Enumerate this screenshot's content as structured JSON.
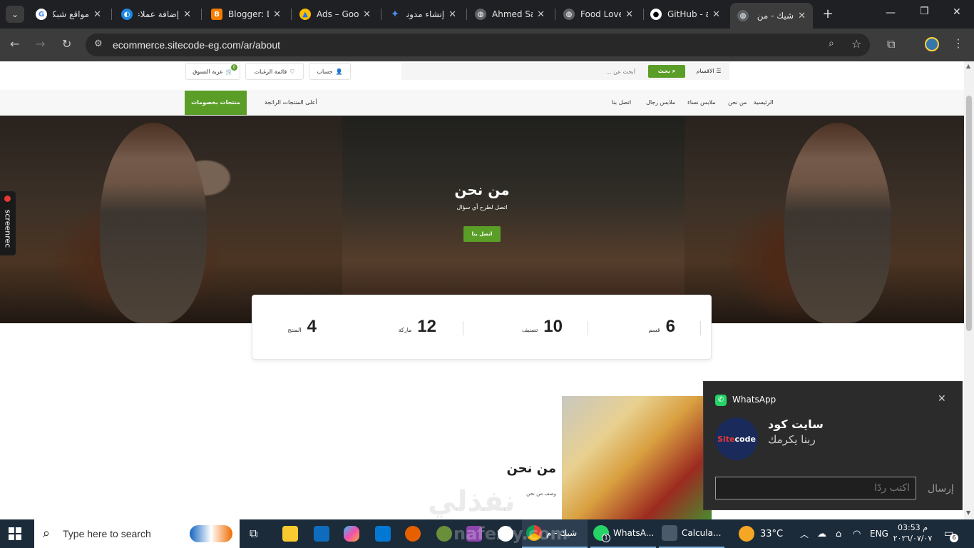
{
  "browser": {
    "tabs": [
      {
        "title": "مواقع شبكة",
        "icon": "google-icon",
        "color": "#4285f4"
      },
      {
        "title": "إضافة عملاء",
        "icon": "blue-app-icon",
        "color": "#1e88e5"
      },
      {
        "title": "Blogger: Dashboard",
        "icon": "blogger-icon",
        "color": "#f57c00"
      },
      {
        "title": "Ads – Google",
        "icon": "google-ads-icon",
        "color": "#fbbc04"
      },
      {
        "title": "إنشاء مدونة",
        "icon": "gemini-icon",
        "color": "#4f8ef7"
      },
      {
        "title": "Ahmed Saber",
        "icon": "globe-icon",
        "color": "#9aa0a6"
      },
      {
        "title": "Food Lover",
        "icon": "globe-icon",
        "color": "#9aa0a6"
      },
      {
        "title": "GitHub - ahmed",
        "icon": "github-icon",
        "color": "#ffffff"
      },
      {
        "title": "شيك - من",
        "icon": "globe-icon",
        "color": "#9aa0a6"
      }
    ],
    "url": "ecommerce.sitecode-eg.com/ar/about"
  },
  "site": {
    "header": {
      "cart_label": "عربة التسوق",
      "cart_count": "0",
      "wishlist_label": "قائمة الرغبات",
      "account_label": "حساب",
      "search_placeholder": "أبحث عن ...",
      "search_button": "بحث",
      "categories_label": "الاقسام"
    },
    "nav": {
      "home": "الرئيسية",
      "about": "من نحن",
      "women": "ملابس نساء",
      "men": "ملابس رجال",
      "contact": "اتصل بنا",
      "bestsellers": "أعلى المنتجات الرائجة",
      "offers": "منتجات بخصومات"
    },
    "hero": {
      "title": "من نحن",
      "subtitle": "اتصل لطرح أي سؤال",
      "button": "اتصل بنا"
    },
    "stats": [
      {
        "number": "6",
        "label": "قسم"
      },
      {
        "number": "10",
        "label": "تصنيف"
      },
      {
        "number": "12",
        "label": "ماركة"
      },
      {
        "number": "4",
        "label": "المنتج"
      }
    ],
    "about": {
      "title": "من نحن",
      "desc": "وصف من نحن"
    },
    "watermark": "نفذلي"
  },
  "side_widget": {
    "label": "screenrec"
  },
  "notification": {
    "app": "WhatsApp",
    "sender": "سايت كود",
    "message": "ربنا يكرمك",
    "reply_placeholder": "اكتب ردًا",
    "send_label": "إرسال"
  },
  "taskbar": {
    "search_placeholder": "Type here to search",
    "open_apps": [
      {
        "label": "شيك - م",
        "icon": "chrome-icon"
      },
      {
        "label": "WhatsA...",
        "icon": "whatsapp-icon"
      },
      {
        "label": "Calcula...",
        "icon": "calculator-icon"
      }
    ],
    "weather": "33°C",
    "lang": "ENG",
    "time": "03:53 م",
    "date": "٢٠٢٦/٠٧/٠٧",
    "notif_count": "6",
    "whatsapp_badge": "1",
    "watermark": "nafezly.com"
  }
}
